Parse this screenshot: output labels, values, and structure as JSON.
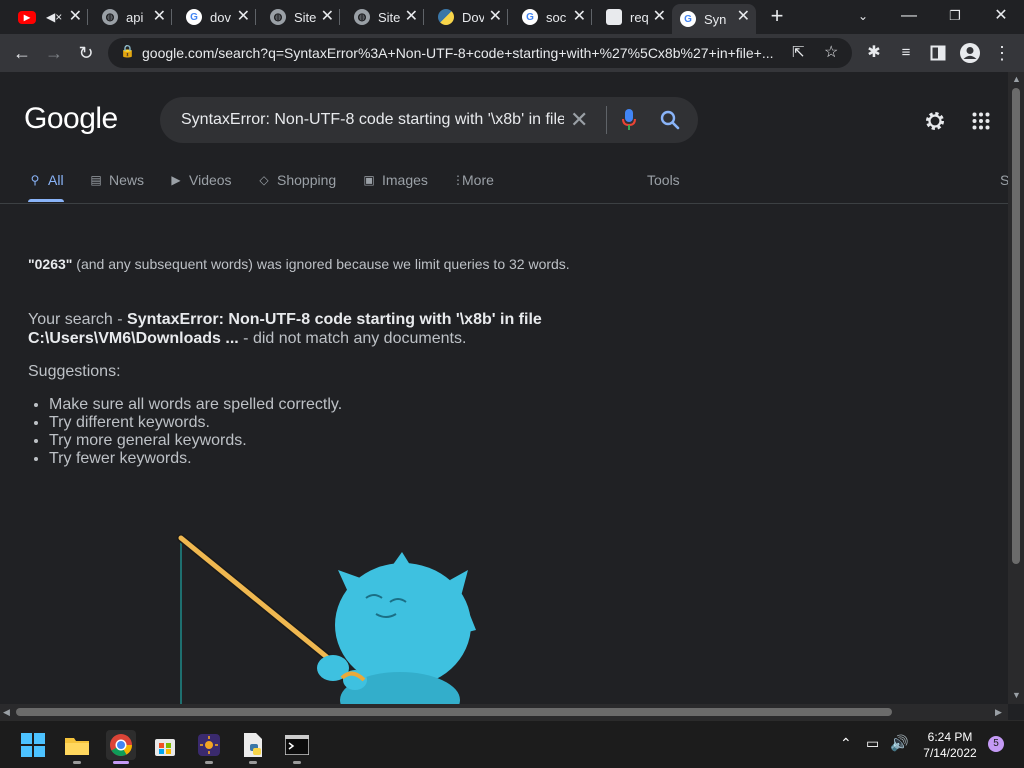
{
  "tabs": [
    {
      "label": "",
      "icon": "youtube-icon",
      "muted": true
    },
    {
      "label": "api",
      "icon": "globe-icon"
    },
    {
      "label": "dov",
      "icon": "google-icon"
    },
    {
      "label": "Site",
      "icon": "globe-icon"
    },
    {
      "label": "Site",
      "icon": "globe-icon"
    },
    {
      "label": "Dov",
      "icon": "python-icon"
    },
    {
      "label": "soc",
      "icon": "google-icon"
    },
    {
      "label": "req",
      "icon": "package-icon"
    },
    {
      "label": "Synt",
      "icon": "google-icon",
      "active": true
    }
  ],
  "toolbar": {
    "url": "google.com/search?q=SyntaxError%3A+Non-UTF-8+code+starting+with+%27%5Cx8b%27+in+file+..."
  },
  "google": {
    "logo": "Google",
    "query": "SyntaxError: Non-UTF-8 code starting with '\\x8b' in file C:\\Users\\VM6\\Downloads"
  },
  "nav": {
    "all": "All",
    "news": "News",
    "videos": "Videos",
    "shopping": "Shopping",
    "images": "Images",
    "more": "More",
    "tools": "Tools",
    "cut": "S"
  },
  "results": {
    "ignored_word": "\"0263\"",
    "ignored_rest": " (and any subsequent words) was ignored because we limit queries to 32 words.",
    "your_search": "Your search - ",
    "search_bold": "SyntaxError: Non-UTF-8 code starting with '\\x8b' in file C:\\Users\\VM6\\Downloads ...",
    "no_match": " - did not match any documents.",
    "suggestions_title": "Suggestions:",
    "suggestions": [
      "Make sure all words are spelled correctly.",
      "Try different keywords.",
      "Try more general keywords.",
      "Try fewer keywords."
    ]
  },
  "taskbar": {
    "time": "6:24 PM",
    "date": "7/14/2022",
    "notifications": "5"
  },
  "colors": {
    "background": "#202124",
    "accent": "#8ab4f8",
    "mascot": "#3ec1e0"
  }
}
